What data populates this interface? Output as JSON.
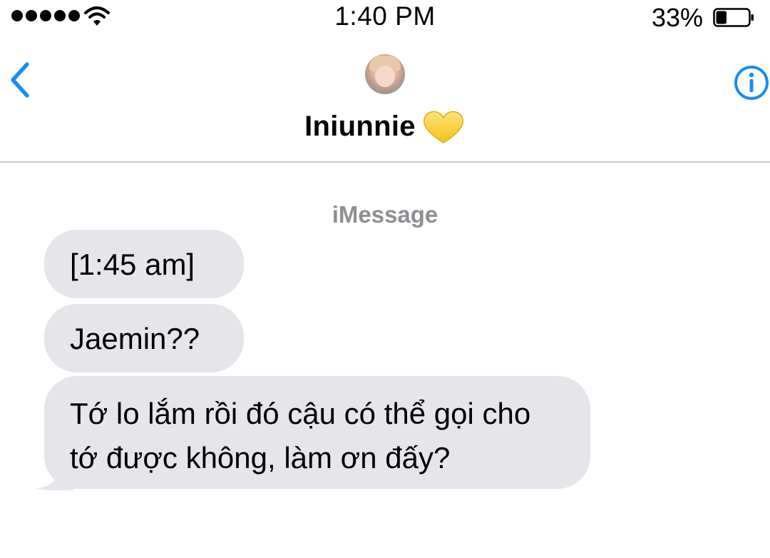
{
  "status_bar": {
    "time": "1:40 PM",
    "battery_percent": "33%",
    "battery_level": 0.33,
    "signal_bars": 5,
    "icons": [
      "signal-dots-icon",
      "wifi-icon",
      "battery-icon"
    ]
  },
  "header": {
    "contact_name": "Iniunnie",
    "contact_emoji": "yellow-heart-icon",
    "back_icon": "chevron-left-icon",
    "info_icon": "info-icon"
  },
  "conversation": {
    "service_label": "iMessage",
    "messages": [
      {
        "text": "[1:45 am]",
        "direction": "received"
      },
      {
        "text": "Jaemin??",
        "direction": "received"
      },
      {
        "text": "Tớ lo lắm rồi đó cậu có thể gọi cho tớ được không, làm ơn đấy?",
        "direction": "received"
      }
    ]
  },
  "colors": {
    "accent": "#1a8cf0",
    "bubble_received": "#e5e5ea",
    "secondary_text": "#8e8e93",
    "heart": "#fbd44a"
  }
}
